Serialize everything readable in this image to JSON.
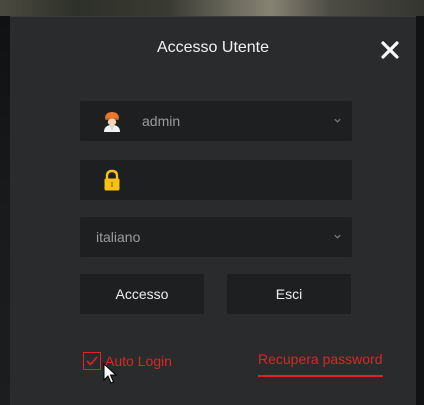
{
  "dialog": {
    "title": "Accesso Utente"
  },
  "form": {
    "username": "admin",
    "password": "",
    "language": "italiano"
  },
  "buttons": {
    "login_label": "Accesso",
    "exit_label": "Esci"
  },
  "options": {
    "auto_login_label": "Auto Login",
    "auto_login_checked": true,
    "recover_password_label": "Recupera password"
  },
  "icons": {
    "close": "close-icon",
    "user": "user-icon",
    "lock": "lock-icon",
    "dropdown": "chevron-down-icon",
    "checkbox": "checkmark-icon"
  },
  "colors": {
    "accent": "#e02424",
    "dialog_bg": "#2a2b2d",
    "field_bg": "#1e1f21",
    "lock_yellow": "#f6c21a",
    "user_orange": "#e8792a"
  }
}
